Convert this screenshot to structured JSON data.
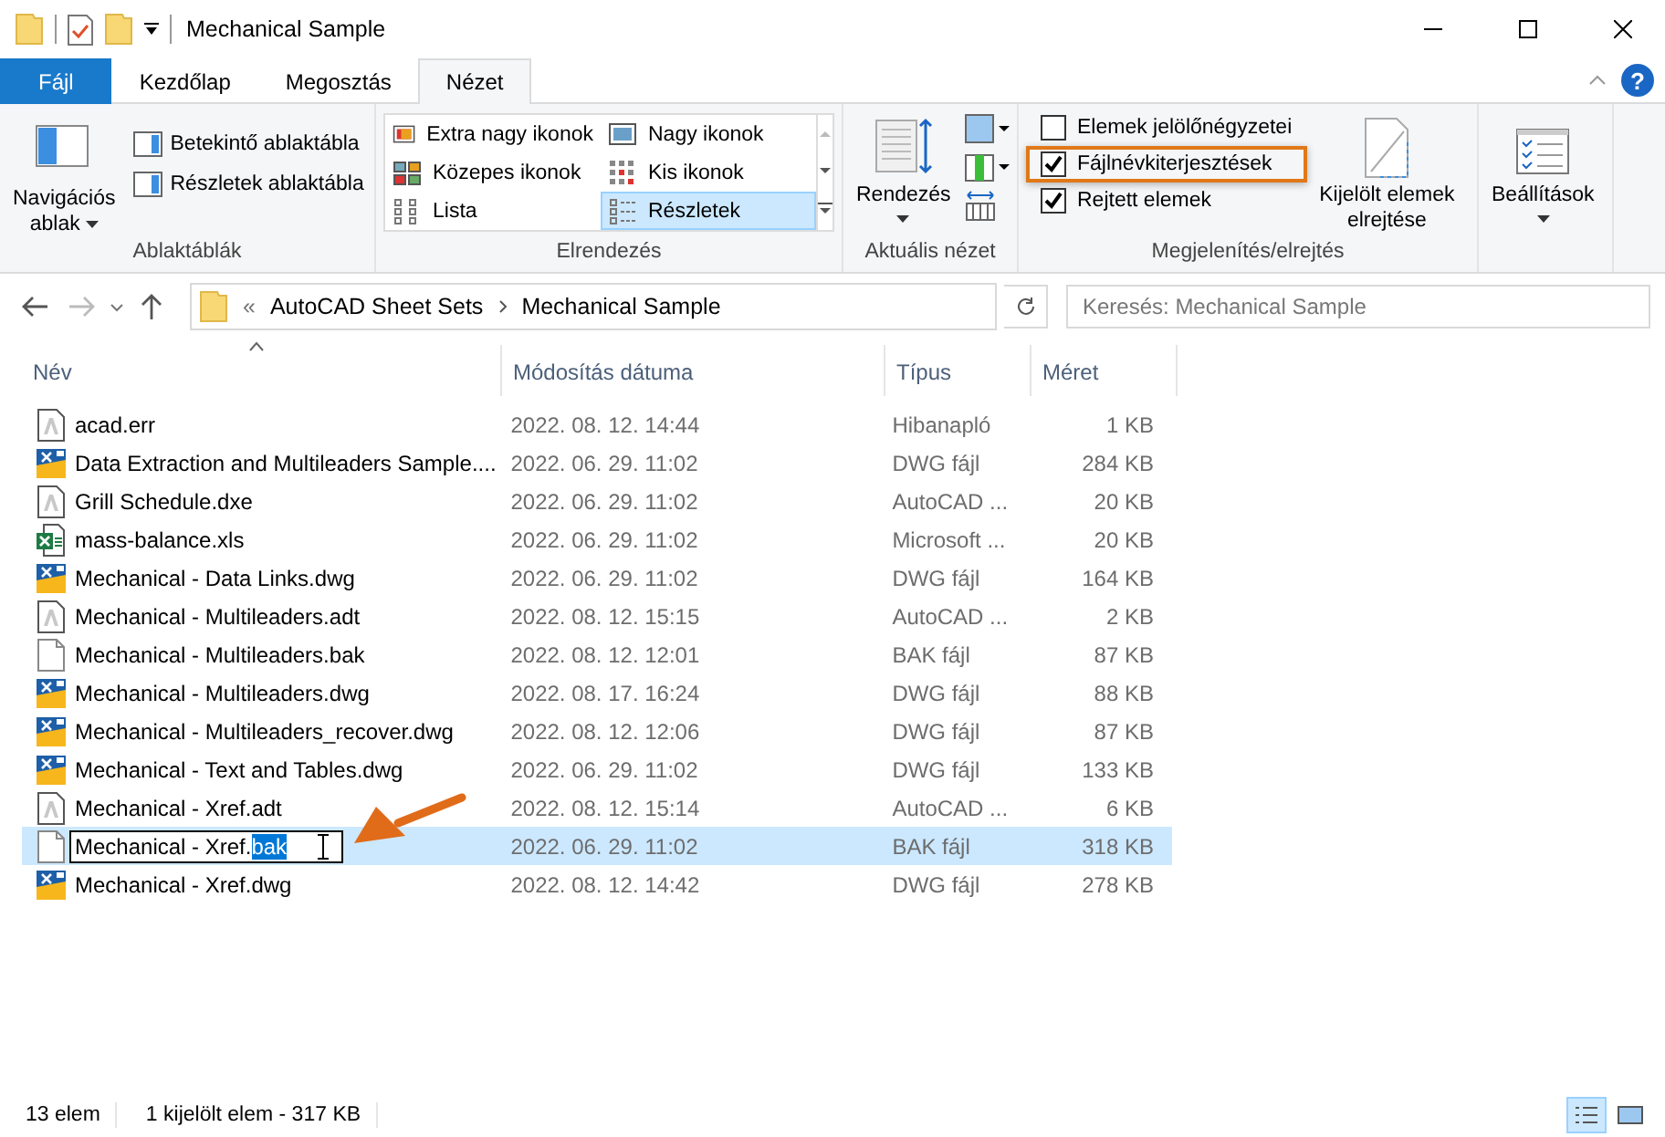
{
  "window": {
    "title": "Mechanical Sample"
  },
  "ribbon_tabs": [
    {
      "label": "Fájl",
      "kind": "file",
      "selected": false
    },
    {
      "label": "Kezdőlap",
      "kind": "tab",
      "selected": false
    },
    {
      "label": "Megosztás",
      "kind": "tab",
      "selected": false
    },
    {
      "label": "Nézet",
      "kind": "tab",
      "selected": true
    }
  ],
  "help_button": "?",
  "ribbon": {
    "panes": {
      "label": "Ablaktáblák",
      "navigation": [
        "Navigációs",
        "ablak"
      ],
      "buttons": [
        "Betekintő ablaktábla",
        "Részletek ablaktábla"
      ]
    },
    "layout": {
      "label": "Elrendezés",
      "options": [
        {
          "label": "Extra nagy ikonok",
          "selected": false
        },
        {
          "label": "Nagy ikonok",
          "selected": false
        },
        {
          "label": "Közepes ikonok",
          "selected": false
        },
        {
          "label": "Kis ikonok",
          "selected": false
        },
        {
          "label": "Lista",
          "selected": false
        },
        {
          "label": "Részletek",
          "selected": true
        }
      ]
    },
    "current_view": {
      "label": "Aktuális nézet",
      "sort": "Rendezés"
    },
    "show_hide": {
      "label": "Megjelenítés/elrejtés",
      "checkboxes": [
        {
          "label": "Elemek jelölőnégyzetei",
          "checked": false,
          "highlighted": false
        },
        {
          "label": "Fájlnévkiterjesztések",
          "checked": true,
          "highlighted": true
        },
        {
          "label": "Rejtett elemek",
          "checked": true,
          "highlighted": false
        }
      ],
      "hide_selected": [
        "Kijelölt elemek",
        "elrejtése"
      ]
    },
    "options": {
      "label": "Beállítások"
    }
  },
  "address_bar": {
    "overflow": "«",
    "crumbs": [
      "AutoCAD Sheet Sets",
      "Mechanical Sample"
    ]
  },
  "search": {
    "placeholder": "Keresés: Mechanical Sample"
  },
  "table": {
    "columns": [
      {
        "label": "Név",
        "sorted": true
      },
      {
        "label": "Módosítás dátuma",
        "sorted": false
      },
      {
        "label": "Típus",
        "sorted": false
      },
      {
        "label": "Méret",
        "sorted": false
      }
    ],
    "rows": [
      {
        "kind": "autocad",
        "name": "acad.err",
        "date": "2022. 08. 12. 14:44",
        "type": "Hibanapló",
        "size": "1 KB",
        "selected": false
      },
      {
        "kind": "dwg",
        "name": "Data Extraction and Multileaders Sample....",
        "date": "2022. 06. 29. 11:02",
        "type": "DWG fájl",
        "size": "284 KB",
        "selected": false
      },
      {
        "kind": "autocad",
        "name": "Grill Schedule.dxe",
        "date": "2022. 06. 29. 11:02",
        "type": "AutoCAD ...",
        "size": "20 KB",
        "selected": false
      },
      {
        "kind": "excel",
        "name": "mass-balance.xls",
        "date": "2022. 06. 29. 11:02",
        "type": "Microsoft ...",
        "size": "20 KB",
        "selected": false
      },
      {
        "kind": "dwg",
        "name": "Mechanical - Data Links.dwg",
        "date": "2022. 06. 29. 11:02",
        "type": "DWG fájl",
        "size": "164 KB",
        "selected": false
      },
      {
        "kind": "autocad",
        "name": "Mechanical - Multileaders.adt",
        "date": "2022. 08. 12. 15:15",
        "type": "AutoCAD ...",
        "size": "2 KB",
        "selected": false
      },
      {
        "kind": "blank",
        "name": "Mechanical - Multileaders.bak",
        "date": "2022. 08. 12. 12:01",
        "type": "BAK fájl",
        "size": "87 KB",
        "selected": false
      },
      {
        "kind": "dwg",
        "name": "Mechanical - Multileaders.dwg",
        "date": "2022. 08. 17. 16:24",
        "type": "DWG fájl",
        "size": "88 KB",
        "selected": false
      },
      {
        "kind": "dwg",
        "name": "Mechanical - Multileaders_recover.dwg",
        "date": "2022. 08. 12. 12:06",
        "type": "DWG fájl",
        "size": "87 KB",
        "selected": false
      },
      {
        "kind": "dwg",
        "name": "Mechanical - Text and Tables.dwg",
        "date": "2022. 06. 29. 11:02",
        "type": "DWG fájl",
        "size": "133 KB",
        "selected": false
      },
      {
        "kind": "autocad",
        "name": "Mechanical - Xref.adt",
        "date": "2022. 08. 12. 15:14",
        "type": "AutoCAD ...",
        "size": "6 KB",
        "selected": false
      },
      {
        "kind": "blank",
        "name": "Mechanical - Xref.",
        "name_selected_part": "bak",
        "editing": true,
        "pointed": true,
        "date": "2022. 06. 29. 11:02",
        "type": "BAK fájl",
        "size": "318 KB",
        "selected": true
      },
      {
        "kind": "dwg",
        "name": "Mechanical - Xref.dwg",
        "date": "2022. 08. 12. 14:42",
        "type": "DWG fájl",
        "size": "278 KB",
        "selected": false
      }
    ]
  },
  "status_bar": {
    "count": "13 elem",
    "selection": "1 kijelölt elem - 317 KB",
    "views": [
      {
        "kind": "details",
        "selected": true
      },
      {
        "kind": "large",
        "selected": false
      }
    ]
  }
}
